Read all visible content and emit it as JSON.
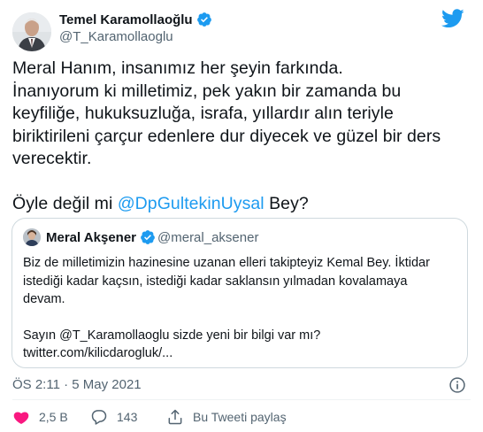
{
  "author": {
    "name": "Temel Karamollaoğlu",
    "handle": "@T_Karamollaoglu"
  },
  "tweet": {
    "lines": [
      "Meral Hanım, insanımız her şeyin farkında.",
      "İnanıyorum ki milletimiz, pek yakın bir zamanda bu",
      "keyfiliğe, hukuksuzluğa, israfa, yıllardır alın teriyle",
      "biriktirileni çarçur edenlere dur diyecek ve güzel bir ders",
      "verecektir."
    ],
    "last_line_prefix": "Öyle değil mi ",
    "last_line_mention": "@DpGultekinUysal",
    "last_line_suffix": " Bey?"
  },
  "quote": {
    "name": "Meral Akşener",
    "handle": "@meral_aksener",
    "lines": [
      "Biz de milletimizin hazinesine uzanan elleri takipteyiz Kemal Bey. İktidar",
      "istediği kadar kaçsın, istediği kadar saklansın yılmadan kovalamaya",
      "devam."
    ],
    "lines2": [
      "Sayın @T_Karamollaoglu sizde yeni bir bilgi var mı?",
      "twitter.com/kilicdarogluk/..."
    ]
  },
  "timestamp": "ÖS 2:11 · 5 May 2021",
  "actions": {
    "likes": "2,5 B",
    "replies": "143",
    "share": "Bu Tweeti paylaş"
  },
  "colors": {
    "accent": "#1d9bf0",
    "like_red": "#f91880",
    "muted": "#536471"
  },
  "icons": [
    "verified-badge-icon",
    "twitter-bird-icon",
    "info-icon",
    "heart-icon",
    "reply-bubble-icon",
    "share-icon"
  ]
}
